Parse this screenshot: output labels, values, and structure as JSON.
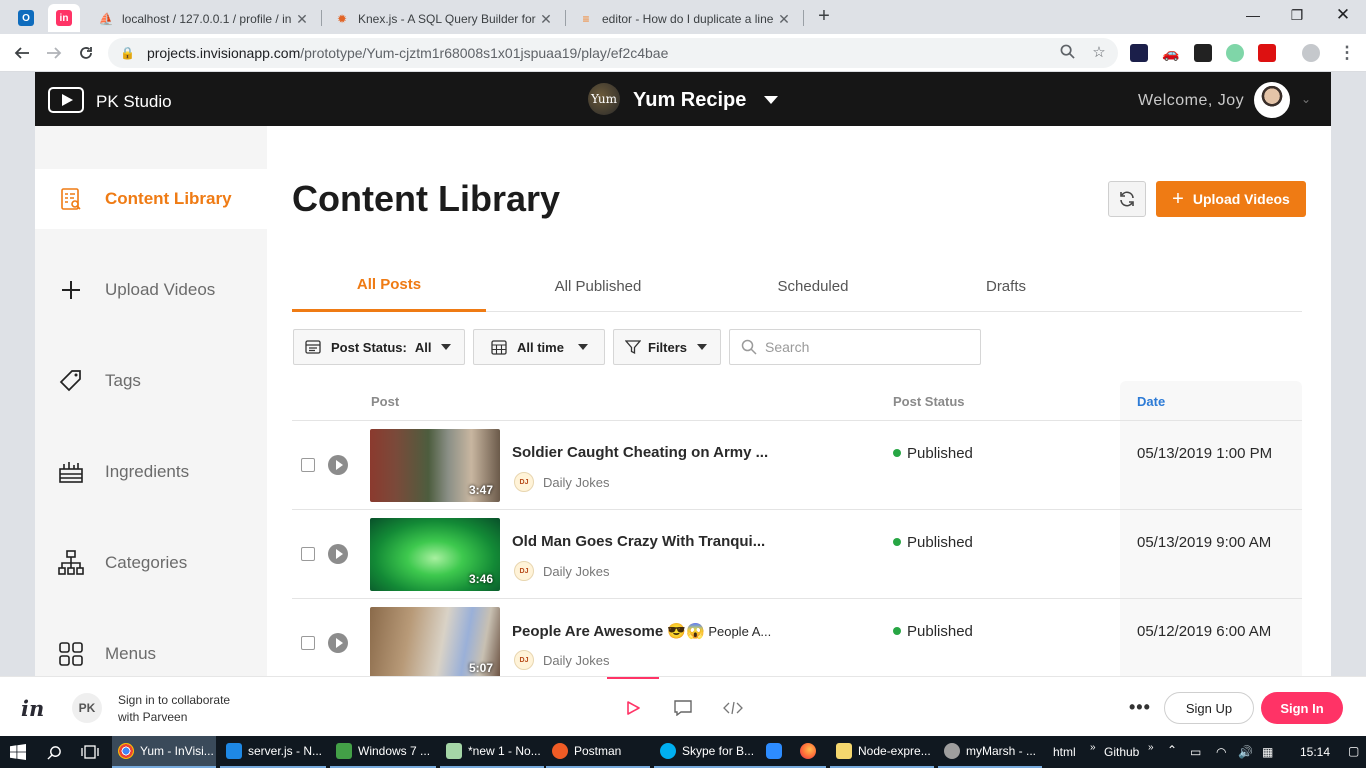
{
  "browser": {
    "tabs": [
      {
        "title": "localhost / 127.0.0.1 / profile / in",
        "icon": "phpmyadmin-icon"
      },
      {
        "title": "Knex.js - A SQL Query Builder for",
        "icon": "knex-icon"
      },
      {
        "title": "editor - How do I duplicate a line",
        "icon": "stackoverflow-icon"
      }
    ],
    "url_host": "projects.invisionapp.com",
    "url_path": "/prototype/Yum-cjztm1r68008s1x01jspuaa19/play/ef2c4bae"
  },
  "header": {
    "brand": "PK Studio",
    "project_logo_text": "Yum",
    "project_name": "Yum Recipe",
    "welcome": "Welcome, Joy"
  },
  "sidebar": {
    "items": [
      {
        "label": "Content Library",
        "icon": "content-library-icon",
        "active": true
      },
      {
        "label": "Upload Videos",
        "icon": "plus-icon"
      },
      {
        "label": "Tags",
        "icon": "tag-icon"
      },
      {
        "label": "Ingredients",
        "icon": "ingredients-icon"
      },
      {
        "label": "Categories",
        "icon": "categories-icon"
      },
      {
        "label": "Menus",
        "icon": "menus-icon"
      }
    ]
  },
  "main": {
    "title": "Content Library",
    "upload_label": "Upload Videos",
    "tabs": [
      {
        "label": "All Posts",
        "active": true
      },
      {
        "label": "All Published"
      },
      {
        "label": "Scheduled"
      },
      {
        "label": "Drafts"
      }
    ],
    "filters": {
      "post_status_label": "Post Status:",
      "post_status_value": "All",
      "time_value": "All time",
      "filters_label": "Filters",
      "search_placeholder": "Search"
    },
    "table": {
      "columns": {
        "post": "Post",
        "status": "Post Status",
        "date": "Date"
      },
      "rows": [
        {
          "title": "Soldier Caught Cheating on Army ...",
          "title_extra": "",
          "duration": "3:47",
          "channel": "Daily Jokes",
          "channel_logo": "Daily Jokes",
          "status": "Published",
          "date": "05/13/2019 1:00 PM"
        },
        {
          "title": "Old Man Goes Crazy With Tranqui...",
          "title_extra": "",
          "duration": "3:46",
          "channel": "Daily Jokes",
          "channel_logo": "Daily Jokes",
          "status": "Published",
          "date": "05/13/2019 9:00 AM"
        },
        {
          "title": "People Are Awesome 😎😱",
          "title_extra": " People A...",
          "duration": "5:07",
          "channel": "Daily Jokes",
          "channel_logo": "Daily Jokes",
          "status": "Published",
          "date": "05/12/2019 6:00 AM"
        }
      ]
    }
  },
  "invision_bar": {
    "logo": "in",
    "avatar_initials": "PK",
    "collab_line1": "Sign in to collaborate",
    "collab_line2": "with Parveen",
    "signup": "Sign Up",
    "signin": "Sign In"
  },
  "taskbar": {
    "items": [
      {
        "label": "Yum - InVisi...",
        "active": true
      },
      {
        "label": "server.js - N..."
      },
      {
        "label": "Windows 7 ..."
      },
      {
        "label": "*new 1 - No..."
      },
      {
        "label": "Postman"
      },
      {
        "label": "Skype for B..."
      },
      {
        "label": "Node-expre..."
      },
      {
        "label": "myMarsh - ..."
      }
    ],
    "html_label": "html",
    "github_label": "Github",
    "clock": "15:14"
  },
  "colors": {
    "accent": "#ef7b14",
    "invision_pink": "#ff3366",
    "published": "#27a644",
    "sorted_column": "#2d7bd6"
  }
}
